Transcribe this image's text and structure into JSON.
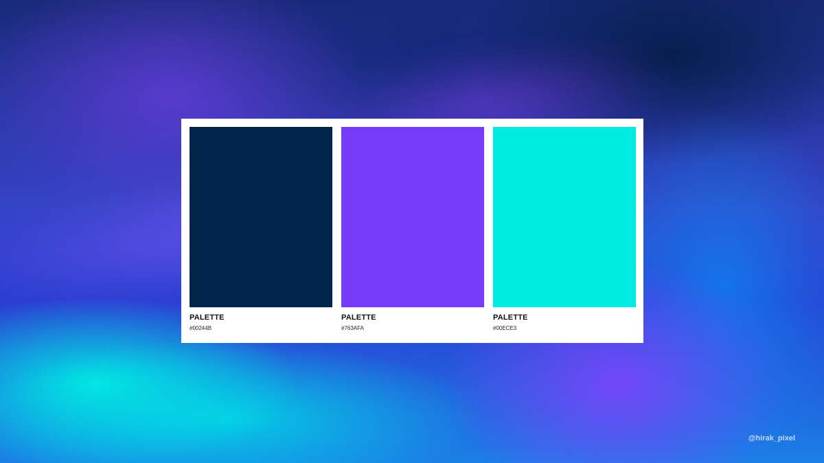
{
  "palette": [
    {
      "label": "PALETTE",
      "code": "#00244B",
      "color": "#00244B"
    },
    {
      "label": "PALETTE",
      "code": "#763AFA",
      "color": "#763AFA"
    },
    {
      "label": "PALETTE",
      "code": "#00ECE3",
      "color": "#00ECE3"
    }
  ],
  "watermark": "@hirak_pixel"
}
